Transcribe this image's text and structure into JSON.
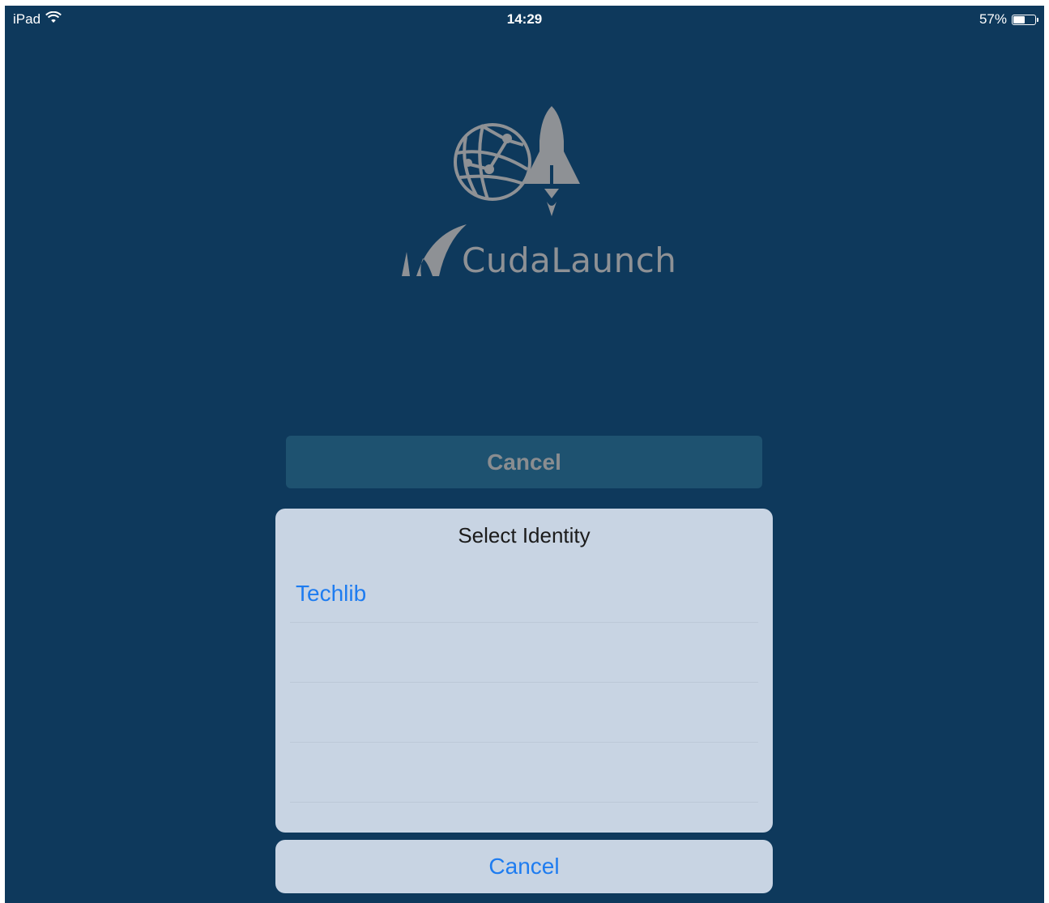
{
  "status_bar": {
    "device": "iPad",
    "time": "14:29",
    "battery_percent": "57%",
    "battery_level": 0.57
  },
  "logo": {
    "app_name": "CudaLaunch"
  },
  "background_button": {
    "label": "Cancel"
  },
  "action_sheet": {
    "title": "Select Identity",
    "items": [
      {
        "label": "Techlib"
      },
      {
        "label": ""
      },
      {
        "label": ""
      },
      {
        "label": ""
      }
    ],
    "cancel_label": "Cancel"
  },
  "colors": {
    "background": "#0e395c",
    "sheet": "#c8d4e3",
    "accent": "#1e7cf0",
    "disabled_button": "#1e5270"
  }
}
